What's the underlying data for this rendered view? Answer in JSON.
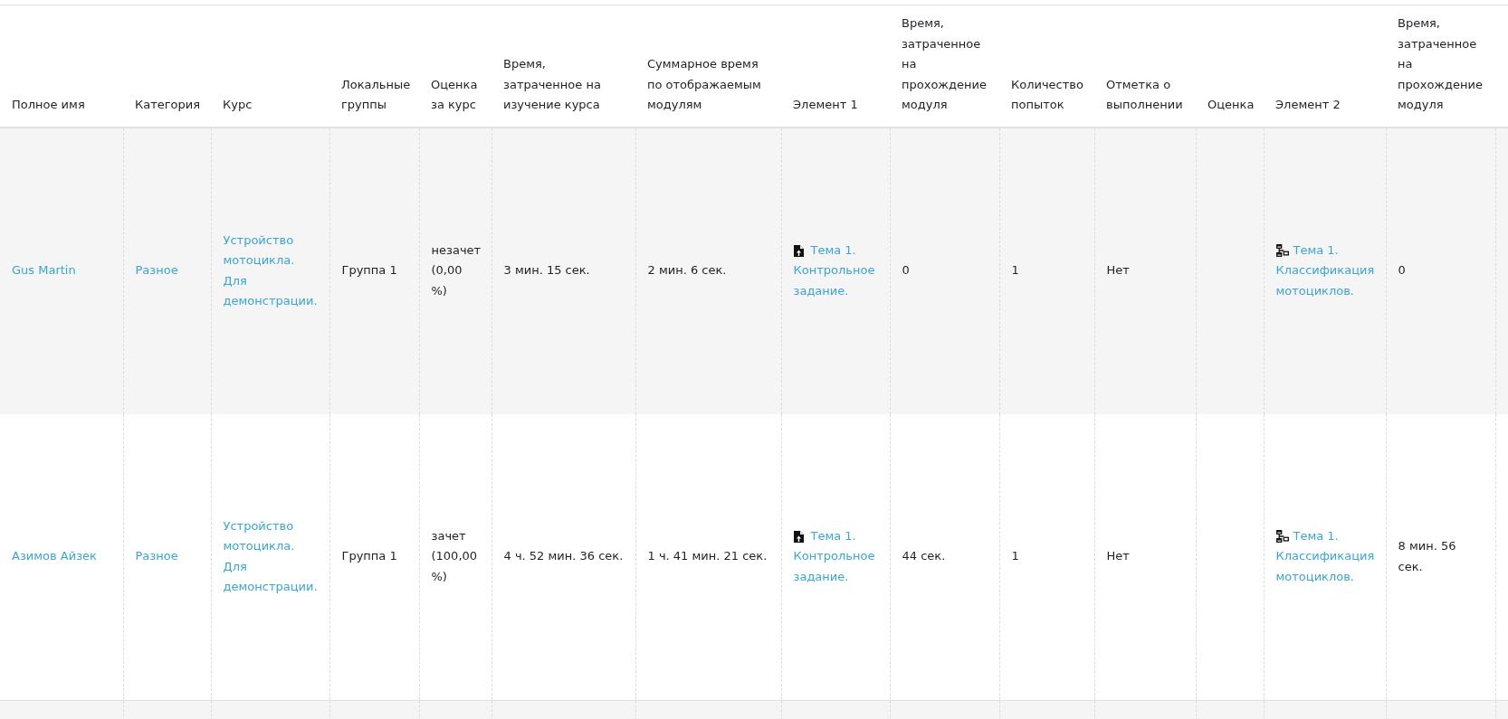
{
  "table": {
    "columns": [
      "Полное имя",
      "Категория",
      "Курс",
      "Локальные группы",
      "Оценка за курс",
      "Время, затраченное на изучение курса",
      "Суммарное время по отображаемым модулям",
      "Элемент 1",
      "Время, затраченное на прохождение модуля",
      "Количество попыток",
      "Отметка о выполнении",
      "Оценка",
      "Элемент 2",
      "Время, затраченное на прохождение модуля"
    ],
    "rows": [
      {
        "cells": [
          {
            "kind": "link",
            "text": "Gus Martin"
          },
          {
            "kind": "link",
            "text": "Разное"
          },
          {
            "kind": "link",
            "text": "Устройство мотоцикла. Для демонстрации."
          },
          {
            "kind": "text",
            "text": "Группа 1"
          },
          {
            "kind": "text",
            "text": "незачет (0,00 %)"
          },
          {
            "kind": "text",
            "text": "3 мин. 15 сек."
          },
          {
            "kind": "text",
            "text": "2 мин. 6 сек."
          },
          {
            "kind": "assignment",
            "text": "Тема 1. Контрольное задание."
          },
          {
            "kind": "text",
            "text": "0"
          },
          {
            "kind": "text",
            "text": "1"
          },
          {
            "kind": "text",
            "text": "Нет"
          },
          {
            "kind": "empty"
          },
          {
            "kind": "lesson",
            "text": "Тема 1. Классификация мотоциклов."
          },
          {
            "kind": "text",
            "text": "0"
          }
        ]
      },
      {
        "cells": [
          {
            "kind": "link",
            "text": "Азимов Айзек"
          },
          {
            "kind": "link",
            "text": "Разное"
          },
          {
            "kind": "link",
            "text": "Устройство мотоцикла. Для демонстрации."
          },
          {
            "kind": "text",
            "text": "Группа 1"
          },
          {
            "kind": "text",
            "text": "зачет (100,00 %)"
          },
          {
            "kind": "text",
            "text": "4 ч. 52 мин. 36 сек."
          },
          {
            "kind": "text",
            "text": "1 ч. 41 мин. 21 сек."
          },
          {
            "kind": "assignment",
            "text": "Тема 1. Контрольное задание."
          },
          {
            "kind": "text",
            "text": "44 сек."
          },
          {
            "kind": "text",
            "text": "1"
          },
          {
            "kind": "text",
            "text": "Нет"
          },
          {
            "kind": "empty"
          },
          {
            "kind": "lesson",
            "text": "Тема 1. Классификация мотоциклов."
          },
          {
            "kind": "text",
            "text": "8 мин. 56 сек."
          }
        ]
      }
    ]
  }
}
